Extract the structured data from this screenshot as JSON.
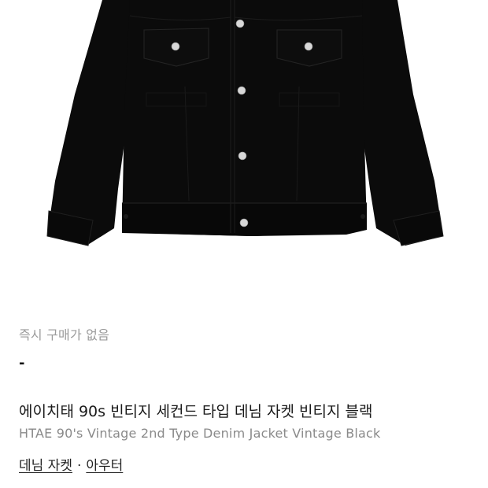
{
  "product": {
    "image_subject": "black denim jacket",
    "availability": "즉시 구매가 없음",
    "price": "-",
    "title_ko": "에이치태 90s 빈티지 세컨드 타입 데님 자켓 빈티지 블랙",
    "title_en": "HTAE 90's Vintage 2nd Type Denim Jacket Vintage Black",
    "categories": [
      {
        "label": "데님 자켓"
      },
      {
        "label": "아우터"
      }
    ],
    "category_separator": "·"
  },
  "colors": {
    "jacket": "#0b0b0b",
    "stitch": "#1e1e1e",
    "button": "#d8d8d8",
    "muted_text": "#9b9b9b"
  }
}
